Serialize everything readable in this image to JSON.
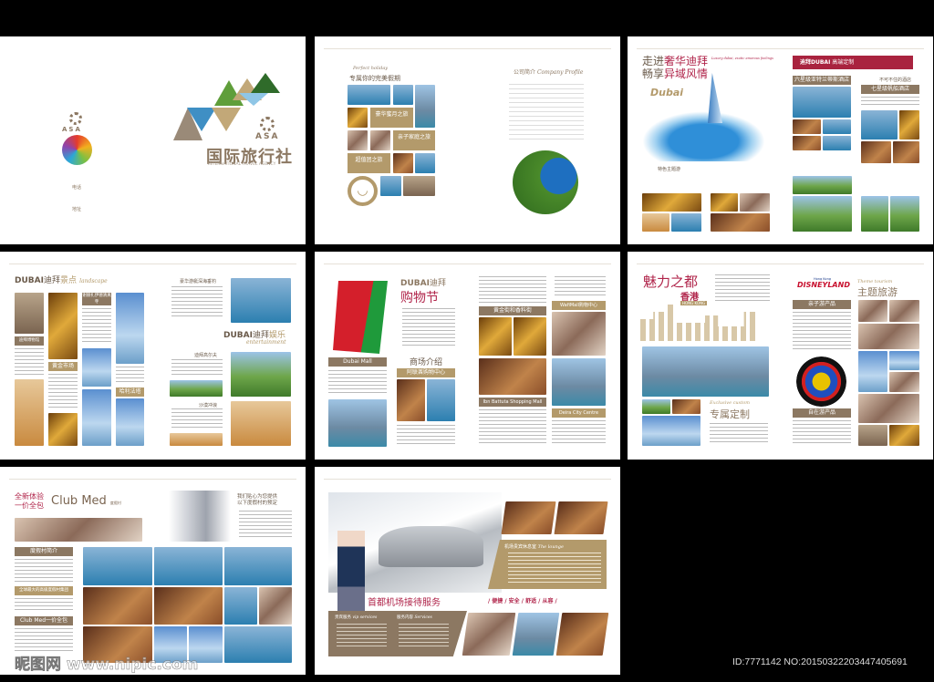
{
  "pages": {
    "cover": {
      "brand": "ASA",
      "title_cn": "国际旅行社",
      "title_en": "INTERNATIONAL TRAVEL AGENCY",
      "phone_label": "电话",
      "address_label": "地址"
    },
    "intro": {
      "script_title": "Perfect holiday",
      "title": "专属你的完美假期",
      "tiles": [
        "豪华蜜月之旅",
        "亲子家庭之旅",
        "超值团之旅"
      ],
      "profile_title": "公司简介",
      "profile_script": "Company Profile"
    },
    "dubai_luxury": {
      "title_line1_a": "走进",
      "title_line1_b": "奢华迪拜",
      "title_line2_a": "畅享",
      "title_line2_b": "异域风情",
      "script": "Luxury dubai, exotic amorous feelings",
      "illustration_word": "Dubai",
      "feature": "特色主题游",
      "red_bar_brand": "迪拜DUBAI",
      "red_bar_title": "高端定制",
      "hotel1": "六星级亚特兰蒂斯酒店",
      "must_stay": "不可不住的酒店",
      "hotel2": "七星级帆船酒店"
    },
    "dubai_sights": {
      "brand": "DUBAI",
      "title_a": "迪拜",
      "title_b": "景点",
      "script": "landscape",
      "labels": [
        "迪拜博物馆",
        "黄金市场",
        "谢赫扎伊德清真寺",
        "哈利法塔"
      ],
      "fishing": "豪华游艇深海垂钓",
      "ent_a": "迪拜",
      "ent_b": "娱乐",
      "ent_script": "entertainment",
      "golf": "迪拜高尔夫",
      "desert": "沙漠冲浪"
    },
    "shopping": {
      "brand": "DUBAI",
      "title_a": "迪拜",
      "title_b": "购物节",
      "malls_title": "商场介绍",
      "labels": [
        "Dubai Mall",
        "阿联酋购物中心",
        "黄金街和香料街",
        "WafiMall购物中心",
        "Ibn Battuta Shopping Mall",
        "Deira City Centre"
      ]
    },
    "hongkong": {
      "title": "魅力之都",
      "city": "香港",
      "city_en": "HONG KONG",
      "custom_script": "Exclusive custom",
      "custom": "专属定制",
      "disney": "DISNEYLAND",
      "disney_sub": "Hong Kong",
      "theme_script": "Theme tourism",
      "theme": "主题旅游",
      "bar1": "亲子游产品",
      "bar2": "自在游产品"
    },
    "clubmed": {
      "slogan1": "全新体验",
      "slogan2": "一价全包",
      "brand": "Club Med",
      "brand_cn": "度假村",
      "promise1": "我们贴心为您提供",
      "promise2": "以下度假村的预定",
      "bars": [
        "度假村简介",
        "全球最大的高级度假村集团",
        "Club Med一价全包"
      ]
    },
    "airport": {
      "title": "首都机场接待服务",
      "values": [
        "便捷",
        "安全",
        "舒适",
        "从容"
      ],
      "lounge": "机场贵宾休息室",
      "lounge_script": "The lounge",
      "vip": "贵宾服务",
      "vip_script": "vip services",
      "services": "服务内容",
      "services_script": "Services"
    }
  },
  "watermark": "昵图网 www.nipic.com",
  "image_id": "ID:7771142 NO:20150322203447405691"
}
